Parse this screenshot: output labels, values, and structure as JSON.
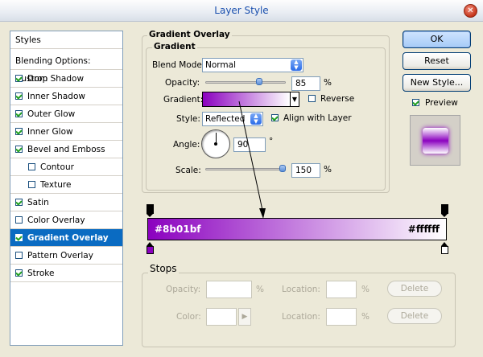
{
  "window": {
    "title": "Layer Style",
    "close_glyph": "✕"
  },
  "styles_list": {
    "header": "Styles",
    "blending": "Blending Options: Custom",
    "items": [
      {
        "label": "Drop Shadow",
        "checked": true,
        "sub": false
      },
      {
        "label": "Inner Shadow",
        "checked": true,
        "sub": false
      },
      {
        "label": "Outer Glow",
        "checked": true,
        "sub": false
      },
      {
        "label": "Inner Glow",
        "checked": true,
        "sub": false
      },
      {
        "label": "Bevel and Emboss",
        "checked": true,
        "sub": false
      },
      {
        "label": "Contour",
        "checked": false,
        "sub": true
      },
      {
        "label": "Texture",
        "checked": false,
        "sub": true
      },
      {
        "label": "Satin",
        "checked": true,
        "sub": false
      },
      {
        "label": "Color Overlay",
        "checked": false,
        "sub": false
      },
      {
        "label": "Gradient Overlay",
        "checked": true,
        "sub": false,
        "selected": true
      },
      {
        "label": "Pattern Overlay",
        "checked": false,
        "sub": false
      },
      {
        "label": "Stroke",
        "checked": true,
        "sub": false
      }
    ]
  },
  "gradient_overlay": {
    "section_title": "Gradient Overlay",
    "group_title": "Gradient",
    "blend_mode_label": "Blend Mode:",
    "blend_mode_value": "Normal",
    "opacity_label": "Opacity:",
    "opacity_value": "85",
    "opacity_unit": "%",
    "opacity_level": 0.85,
    "gradient_label": "Gradient:",
    "reverse_label": "Reverse",
    "reverse_checked": false,
    "style_label": "Style:",
    "style_value": "Reflected",
    "align_label": "Align with Layer",
    "align_checked": true,
    "angle_label": "Angle:",
    "angle_value": "90",
    "angle_unit": "°",
    "scale_label": "Scale:",
    "scale_value": "150",
    "scale_unit": "%",
    "scale_level": 1.0
  },
  "gradient_editor": {
    "start_color_label": "#8b01bf",
    "end_color_label": "#ffffff",
    "start_color": "#8b01bf",
    "end_color": "#ffffff",
    "stops_title": "Stops",
    "opacity_label": "Opacity:",
    "color_label": "Color:",
    "location_label": "Location:",
    "percent": "%",
    "delete_label": "Delete"
  },
  "buttons": {
    "ok": "OK",
    "reset": "Reset",
    "new_style": "New Style...",
    "preview_label": "Preview",
    "preview_checked": true
  },
  "colors": {
    "accent": "#0a6bc2",
    "gradient_start": "#8b01bf",
    "gradient_end": "#ffffff"
  }
}
